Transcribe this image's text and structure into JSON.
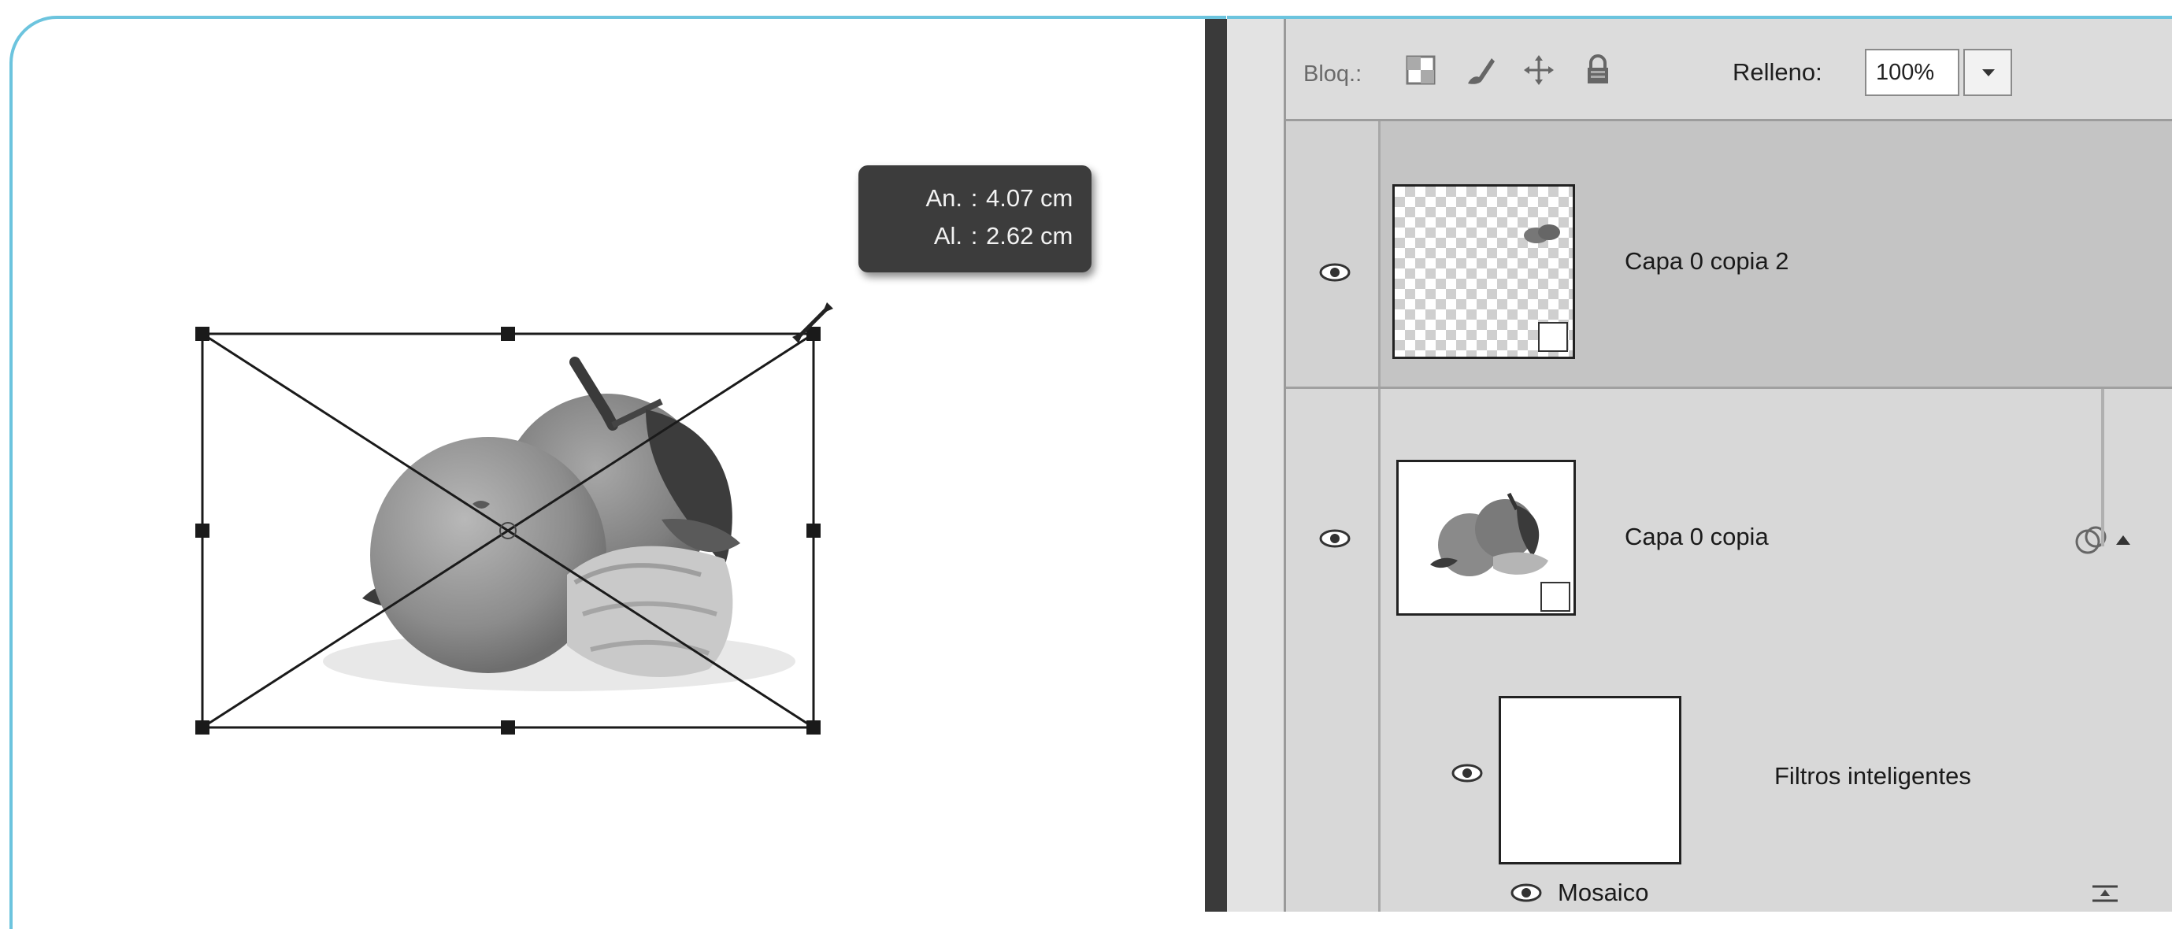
{
  "canvas": {
    "image_description": "mandarins-image",
    "tooltip": {
      "width_label": "An.",
      "width_value": "4.07 cm",
      "height_label": "Al.",
      "height_value": "2.62 cm",
      "separator": ":"
    }
  },
  "layers_panel": {
    "lock_label": "Bloq.:",
    "lock_icons": [
      "lock-transparent-pixels-icon",
      "lock-image-pixels-icon",
      "lock-position-icon",
      "lock-all-icon"
    ],
    "fill_label": "Relleno:",
    "fill_value": "100%",
    "layers": [
      {
        "name": "Capa 0 copia 2",
        "selected": true,
        "smart_object": true
      },
      {
        "name": "Capa 0 copia",
        "selected": false,
        "smart_object": true
      },
      {
        "name": "Filtros inteligentes",
        "selected": false,
        "type": "smart-filters-mask"
      },
      {
        "name": "Mosaico",
        "selected": false,
        "type": "filter"
      }
    ]
  },
  "colors": {
    "frame_accent": "#6cc4de",
    "panel_bg": "#d4d4d4",
    "selected_layer_bg": "#bdbdbd",
    "tooltip_bg": "#3c3c3c"
  }
}
